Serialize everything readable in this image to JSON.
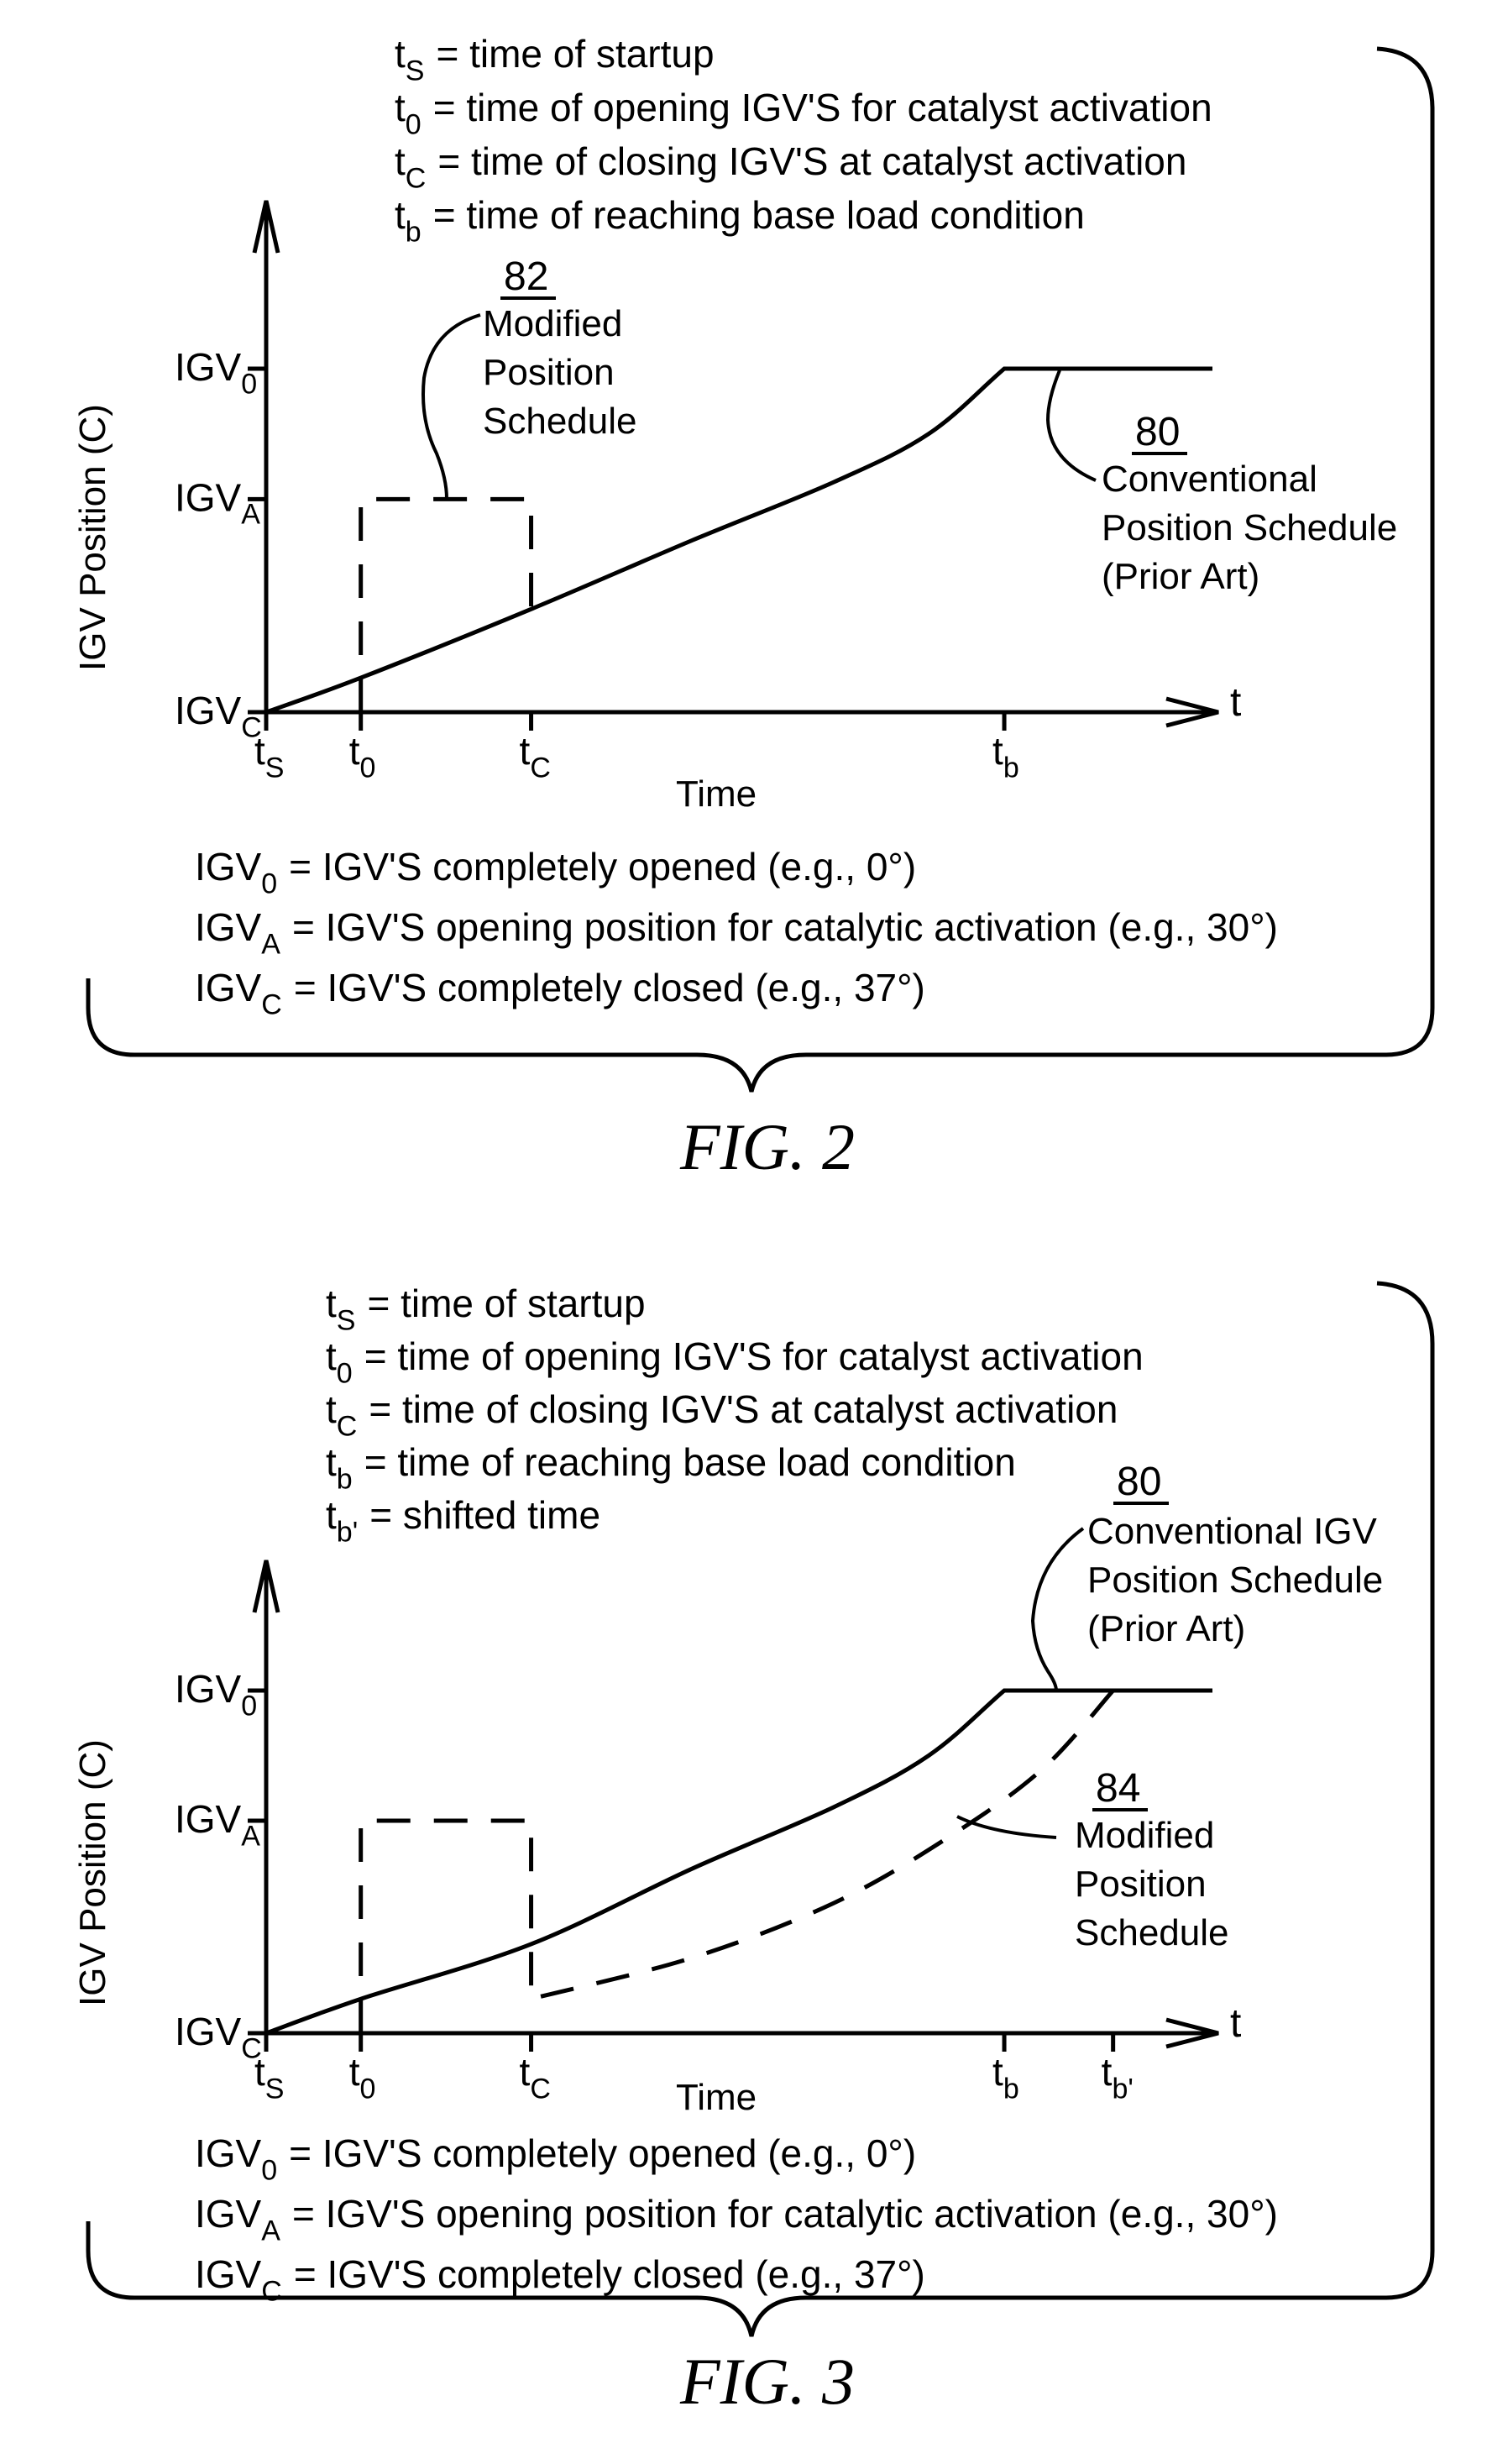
{
  "chart_data": [
    {
      "type": "line",
      "figure_label": "FIG. 2",
      "xlabel": "Time",
      "ylabel": "IGV Position (C)",
      "x_axis_end_label": "t",
      "x_ticks": [
        {
          "base": "t",
          "sub": "S",
          "t": 0.0
        },
        {
          "base": "t",
          "sub": "0",
          "t": 0.1
        },
        {
          "base": "t",
          "sub": "C",
          "t": 0.28
        },
        {
          "base": "t",
          "sub": "b",
          "t": 0.78
        }
      ],
      "y_ticks": [
        {
          "base": "IGV",
          "sub": "0",
          "level": 1.0
        },
        {
          "base": "IGV",
          "sub": "A",
          "level": 0.62
        },
        {
          "base": "IGV",
          "sub": "C",
          "level": 0.0
        }
      ],
      "definitions_top": [
        {
          "base": "t",
          "sub": "S",
          "text": "= time of startup"
        },
        {
          "base": "t",
          "sub": "0",
          "text": "= time of opening IGV'S for catalyst activation"
        },
        {
          "base": "t",
          "sub": "C",
          "text": "= time of closing IGV'S at catalyst activation"
        },
        {
          "base": "t",
          "sub": "b",
          "text": "= time of reaching base load condition"
        }
      ],
      "definitions_bottom": [
        {
          "base": "IGV",
          "sub": "0",
          "text": "= IGV'S completely opened (e.g., 0°)"
        },
        {
          "base": "IGV",
          "sub": "A",
          "text": "= IGV'S opening position for catalytic activation (e.g., 30°)"
        },
        {
          "base": "IGV",
          "sub": "C",
          "text": "= IGV'S completely closed (e.g., 37°)"
        }
      ],
      "series": [
        {
          "name": "Conventional Position Schedule (Prior Art)",
          "ref": "80",
          "style": "solid",
          "points": [
            [
              0.0,
              0.0
            ],
            [
              0.1,
              0.1
            ],
            [
              0.28,
              0.3
            ],
            [
              0.45,
              0.5
            ],
            [
              0.6,
              0.67
            ],
            [
              0.7,
              0.81
            ],
            [
              0.78,
              1.0
            ],
            [
              1.0,
              1.0
            ]
          ]
        },
        {
          "name": "Modified Position Schedule",
          "ref": "82",
          "style": "dashed",
          "points": [
            [
              0.1,
              0.0
            ],
            [
              0.1,
              0.62
            ],
            [
              0.28,
              0.62
            ],
            [
              0.28,
              0.3
            ]
          ]
        }
      ],
      "annotations": [
        {
          "ref": "82",
          "lines": [
            "Modified",
            "Position",
            "Schedule"
          ]
        },
        {
          "ref": "80",
          "lines": [
            "Conventional",
            "Position Schedule",
            "(Prior Art)"
          ]
        }
      ]
    },
    {
      "type": "line",
      "figure_label": "FIG. 3",
      "xlabel": "Time",
      "ylabel": "IGV Position (C)",
      "x_axis_end_label": "t",
      "x_ticks": [
        {
          "base": "t",
          "sub": "S",
          "t": 0.0
        },
        {
          "base": "t",
          "sub": "0",
          "t": 0.1
        },
        {
          "base": "t",
          "sub": "C",
          "t": 0.28
        },
        {
          "base": "t",
          "sub": "b",
          "t": 0.78
        },
        {
          "base": "t",
          "sub": "b'",
          "t": 0.895
        }
      ],
      "y_ticks": [
        {
          "base": "IGV",
          "sub": "0",
          "level": 1.0
        },
        {
          "base": "IGV",
          "sub": "A",
          "level": 0.62
        },
        {
          "base": "IGV",
          "sub": "C",
          "level": 0.0
        }
      ],
      "definitions_top": [
        {
          "base": "t",
          "sub": "S",
          "text": "= time of startup"
        },
        {
          "base": "t",
          "sub": "0",
          "text": "= time of opening IGV'S for catalyst activation"
        },
        {
          "base": "t",
          "sub": "C",
          "text": "= time of closing IGV'S at catalyst activation"
        },
        {
          "base": "t",
          "sub": "b",
          "text": "= time of reaching base load condition"
        },
        {
          "base": "t",
          "sub": "b'",
          "text": "= shifted time"
        }
      ],
      "definitions_bottom": [
        {
          "base": "IGV",
          "sub": "0",
          "text": "= IGV'S completely opened (e.g., 0°)"
        },
        {
          "base": "IGV",
          "sub": "A",
          "text": "= IGV'S opening position for catalytic activation (e.g., 30°)"
        },
        {
          "base": "IGV",
          "sub": "C",
          "text": "= IGV'S completely closed (e.g., 37°)"
        }
      ],
      "series": [
        {
          "name": "Conventional IGV Position Schedule (Prior Art)",
          "ref": "80",
          "style": "solid",
          "points": [
            [
              0.0,
              0.0
            ],
            [
              0.1,
              0.1
            ],
            [
              0.28,
              0.26
            ],
            [
              0.45,
              0.48
            ],
            [
              0.6,
              0.66
            ],
            [
              0.7,
              0.81
            ],
            [
              0.78,
              1.0
            ],
            [
              1.0,
              1.0
            ]
          ]
        },
        {
          "name": "Modified Position Schedule",
          "ref": "84",
          "style": "dashed",
          "points": [
            [
              0.1,
              0.0
            ],
            [
              0.1,
              0.62
            ],
            [
              0.28,
              0.62
            ],
            [
              0.28,
              0.1
            ],
            [
              0.45,
              0.22
            ],
            [
              0.6,
              0.38
            ],
            [
              0.72,
              0.57
            ],
            [
              0.82,
              0.77
            ],
            [
              0.895,
              1.0
            ]
          ]
        }
      ],
      "annotations": [
        {
          "ref": "80",
          "lines": [
            "Conventional IGV",
            "Position Schedule",
            "(Prior Art)"
          ]
        },
        {
          "ref": "84",
          "lines": [
            "Modified",
            "Position",
            "Schedule"
          ]
        }
      ]
    }
  ]
}
